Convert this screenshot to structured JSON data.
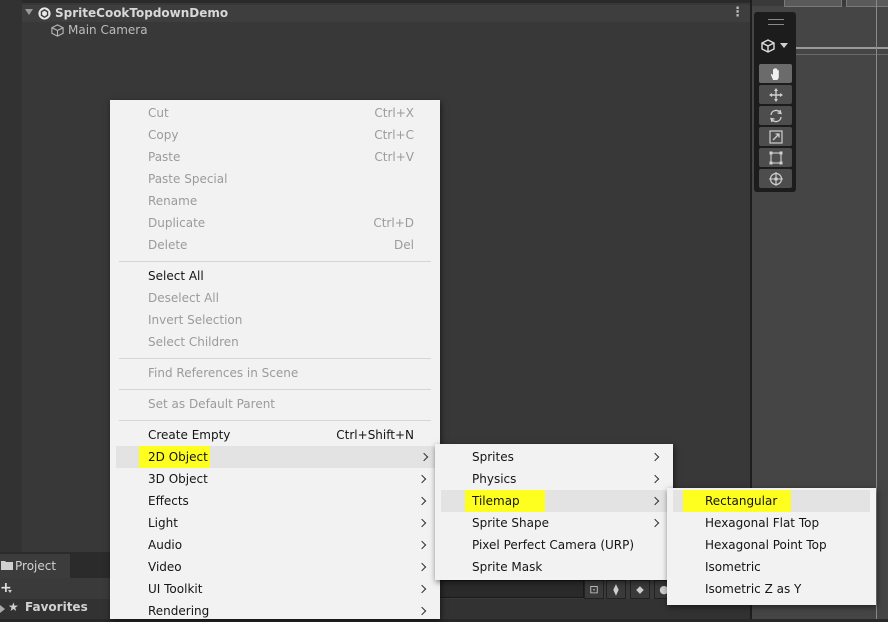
{
  "hierarchy": {
    "scene_name": "SpriteCookTopdownDemo",
    "objects": [
      "Main Camera"
    ]
  },
  "project": {
    "tab_label": "Project",
    "add_label": "+",
    "favorites_label": "Favorites"
  },
  "context_menu": {
    "cut": {
      "label": "Cut",
      "shortcut": "Ctrl+X"
    },
    "copy": {
      "label": "Copy",
      "shortcut": "Ctrl+C"
    },
    "paste": {
      "label": "Paste",
      "shortcut": "Ctrl+V"
    },
    "paste_special": {
      "label": "Paste Special"
    },
    "rename": {
      "label": "Rename"
    },
    "duplicate": {
      "label": "Duplicate",
      "shortcut": "Ctrl+D"
    },
    "delete": {
      "label": "Delete",
      "shortcut": "Del"
    },
    "select_all": {
      "label": "Select All"
    },
    "deselect_all": {
      "label": "Deselect All"
    },
    "invert_selection": {
      "label": "Invert Selection"
    },
    "select_children": {
      "label": "Select Children"
    },
    "find_references": {
      "label": "Find References in Scene"
    },
    "set_default_parent": {
      "label": "Set as Default Parent"
    },
    "create_empty": {
      "label": "Create Empty",
      "shortcut": "Ctrl+Shift+N"
    },
    "object_2d": {
      "label": "2D Object"
    },
    "object_3d": {
      "label": "3D Object"
    },
    "effects": {
      "label": "Effects"
    },
    "light": {
      "label": "Light"
    },
    "audio": {
      "label": "Audio"
    },
    "video": {
      "label": "Video"
    },
    "ui_toolkit": {
      "label": "UI Toolkit"
    },
    "rendering": {
      "label": "Rendering"
    }
  },
  "submenu_2d": {
    "sprites": "Sprites",
    "physics": "Physics",
    "tilemap": "Tilemap",
    "sprite_shape": "Sprite Shape",
    "pixel_perfect_camera": "Pixel Perfect Camera (URP)",
    "sprite_mask": "Sprite Mask"
  },
  "submenu_tilemap": {
    "rectangular": "Rectangular",
    "hex_flat_top": "Hexagonal Flat Top",
    "hex_point_top": "Hexagonal Point Top",
    "isometric": "Isometric",
    "isometric_z_as_y": "Isometric Z as Y"
  },
  "colors": {
    "highlight": "#ffff1f",
    "menu_background": "#f2f2f2",
    "disabled_text": "#9b9b9b",
    "editor_background": "#383838"
  },
  "icons": [
    "unity-scene-icon",
    "gameobject-cube-icon",
    "hand-tool-icon",
    "move-tool-icon",
    "rotate-tool-icon",
    "scale-tool-icon",
    "rect-tool-icon",
    "transform-tool-icon",
    "folder-icon",
    "star-icon",
    "submenu-arrow-icon"
  ]
}
